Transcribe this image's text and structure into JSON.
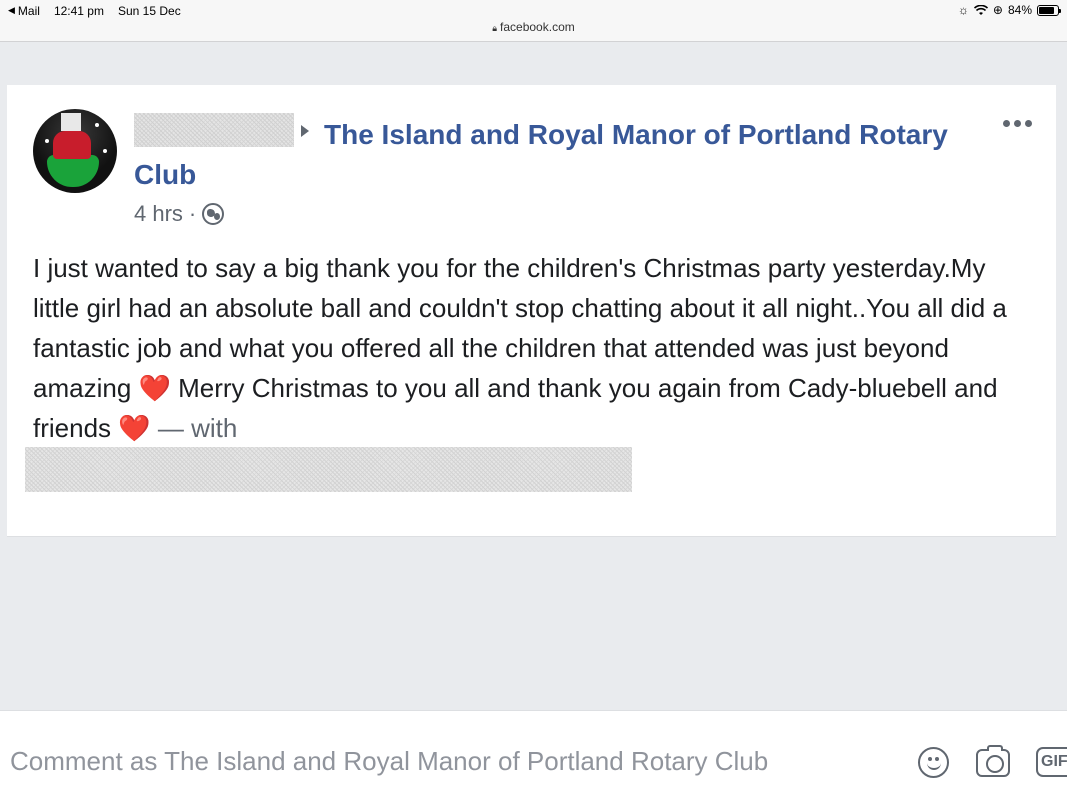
{
  "status_bar": {
    "back_app": "Mail",
    "time": "12:41 pm",
    "date": "Sun 15 Dec",
    "battery": "84%",
    "battery_level": 0.84
  },
  "address_bar": {
    "url": "facebook.com"
  },
  "post": {
    "group_name": "The Island and Royal Manor of Portland Rotary Club",
    "time_ago": "4 hrs",
    "separator": "·",
    "text_part1": "I just wanted to say a big thank you for the children's Christmas party yesterday.My little girl had an absolute ball and couldn't stop chatting about it all night..You all did a fantastic job and what you offered all the children that attended was just beyond amazing",
    "heart": "❤️",
    "text_part2": "Merry Christmas to you all and thank you again from Cady-bluebell and friends",
    "with_text": "— with"
  },
  "comment_bar": {
    "placeholder": "Comment as The Island and Royal Manor of Portland Rotary Club",
    "gif_label": "GIF"
  },
  "icons": {
    "back": "back-arrow-icon",
    "wifi": "wifi-icon",
    "lock": "lock-icon",
    "arrow": "arrow-right-icon",
    "more": "more-icon",
    "globe": "globe-icon",
    "smile": "smile-icon",
    "camera": "camera-icon",
    "gif": "gif-icon"
  },
  "colors": {
    "link": "#385898",
    "secondary": "#606770",
    "heart": "#e0245e",
    "background": "#e9ebee"
  }
}
